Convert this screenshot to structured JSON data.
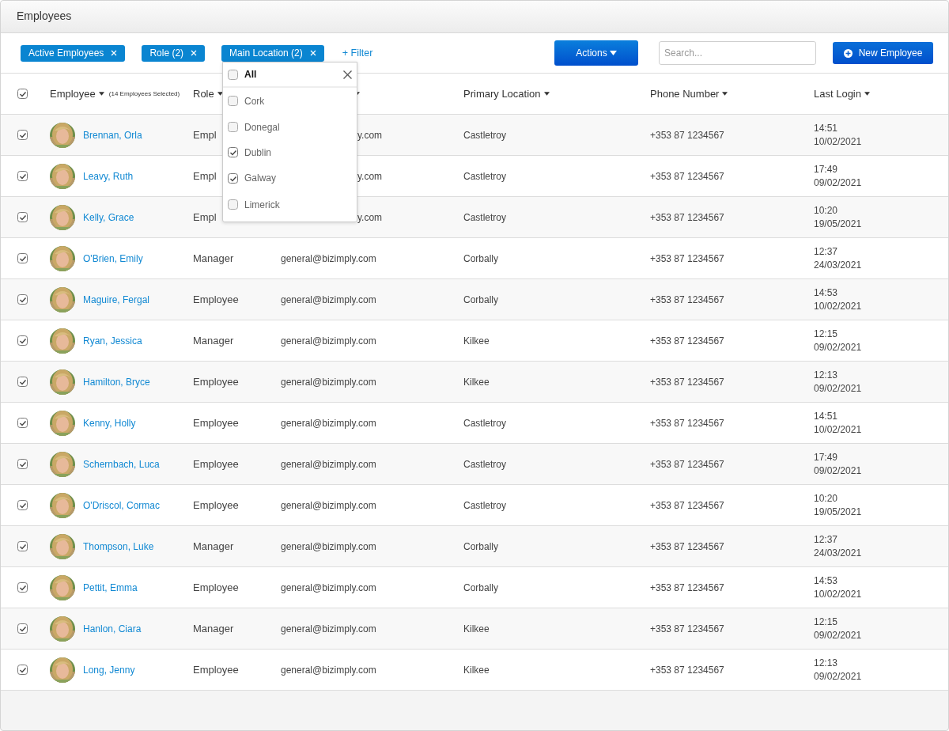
{
  "window": {
    "title": "Employees"
  },
  "filters": [
    {
      "label": "Active Employees"
    },
    {
      "label": "Role (2)"
    },
    {
      "label": "Main Location (2)"
    }
  ],
  "add_filter": "+ Filter",
  "actions_button": "Actions",
  "search": {
    "placeholder": "Search..."
  },
  "new_button": "New Employee",
  "location_dropdown": {
    "all": {
      "label": "All",
      "checked": false
    },
    "options": [
      {
        "label": "Cork",
        "checked": false
      },
      {
        "label": "Donegal",
        "checked": false
      },
      {
        "label": "Dublin",
        "checked": true
      },
      {
        "label": "Galway",
        "checked": true
      },
      {
        "label": "Limerick",
        "checked": false
      }
    ]
  },
  "table": {
    "all_checked": true,
    "columns": [
      {
        "label": "Employee",
        "note": "(14 Employees Selected)",
        "sortable": true
      },
      {
        "label": "Role",
        "sortable": true
      },
      {
        "sortable": true
      },
      {
        "label": "Primary Location",
        "sortable": true
      },
      {
        "label": "Phone Number",
        "sortable": true
      },
      {
        "label": "Last Login",
        "sortable": true
      }
    ],
    "rows": [
      {
        "checked": true,
        "name": "Brennan, Orla",
        "role": "Empl",
        "email": "y.com",
        "location": "Castletroy",
        "phone": "+353 87 1234567",
        "time": "14:51",
        "date": "10/02/2021"
      },
      {
        "checked": true,
        "name": "Leavy, Ruth",
        "role": "Empl",
        "email": "y.com",
        "location": "Castletroy",
        "phone": "+353 87 1234567",
        "time": "17:49",
        "date": "09/02/2021"
      },
      {
        "checked": true,
        "name": "Kelly, Grace",
        "role": "Empl",
        "email": "y.com",
        "location": "Castletroy",
        "phone": "+353 87 1234567",
        "time": "10:20",
        "date": "19/05/2021"
      },
      {
        "checked": true,
        "name": "O'Brien, Emily",
        "role": "Manager",
        "email": "general@bizimply.com",
        "location": "Corbally",
        "phone": "+353 87 1234567",
        "time": "12:37",
        "date": "24/03/2021"
      },
      {
        "checked": true,
        "name": "Maguire, Fergal",
        "role": "Employee",
        "email": "general@bizimply.com",
        "location": "Corbally",
        "phone": "+353 87 1234567",
        "time": "14:53",
        "date": "10/02/2021"
      },
      {
        "checked": true,
        "name": "Ryan, Jessica",
        "role": "Manager",
        "email": "general@bizimply.com",
        "location": "Kilkee",
        "phone": "+353 87 1234567",
        "time": "12:15",
        "date": "09/02/2021"
      },
      {
        "checked": true,
        "name": "Hamilton, Bryce",
        "role": "Employee",
        "email": "general@bizimply.com",
        "location": "Kilkee",
        "phone": "+353 87 1234567",
        "time": "12:13",
        "date": "09/02/2021"
      },
      {
        "checked": true,
        "name": "Kenny, Holly",
        "role": "Employee",
        "email": "general@bizimply.com",
        "location": "Castletroy",
        "phone": "+353 87 1234567",
        "time": "14:51",
        "date": "10/02/2021"
      },
      {
        "checked": true,
        "name": "Schernbach, Luca",
        "role": "Employee",
        "email": "general@bizimply.com",
        "location": "Castletroy",
        "phone": "+353 87 1234567",
        "time": "17:49",
        "date": "09/02/2021"
      },
      {
        "checked": true,
        "name": "O'Driscol, Cormac",
        "role": "Employee",
        "email": "general@bizimply.com",
        "location": "Castletroy",
        "phone": "+353 87 1234567",
        "time": "10:20",
        "date": "19/05/2021"
      },
      {
        "checked": true,
        "name": "Thompson, Luke",
        "role": "Manager",
        "email": "general@bizimply.com",
        "location": "Corbally",
        "phone": "+353 87 1234567",
        "time": "12:37",
        "date": "24/03/2021"
      },
      {
        "checked": true,
        "name": "Pettit, Emma",
        "role": "Employee",
        "email": "general@bizimply.com",
        "location": "Corbally",
        "phone": "+353 87 1234567",
        "time": "14:53",
        "date": "10/02/2021"
      },
      {
        "checked": true,
        "name": "Hanlon, Ciara",
        "role": "Manager",
        "email": "general@bizimply.com",
        "location": "Kilkee",
        "phone": "+353 87 1234567",
        "time": "12:15",
        "date": "09/02/2021"
      },
      {
        "checked": true,
        "name": "Long, Jenny",
        "role": "Employee",
        "email": "general@bizimply.com",
        "location": "Kilkee",
        "phone": "+353 87 1234567",
        "time": "12:13",
        "date": "09/02/2021"
      }
    ]
  }
}
